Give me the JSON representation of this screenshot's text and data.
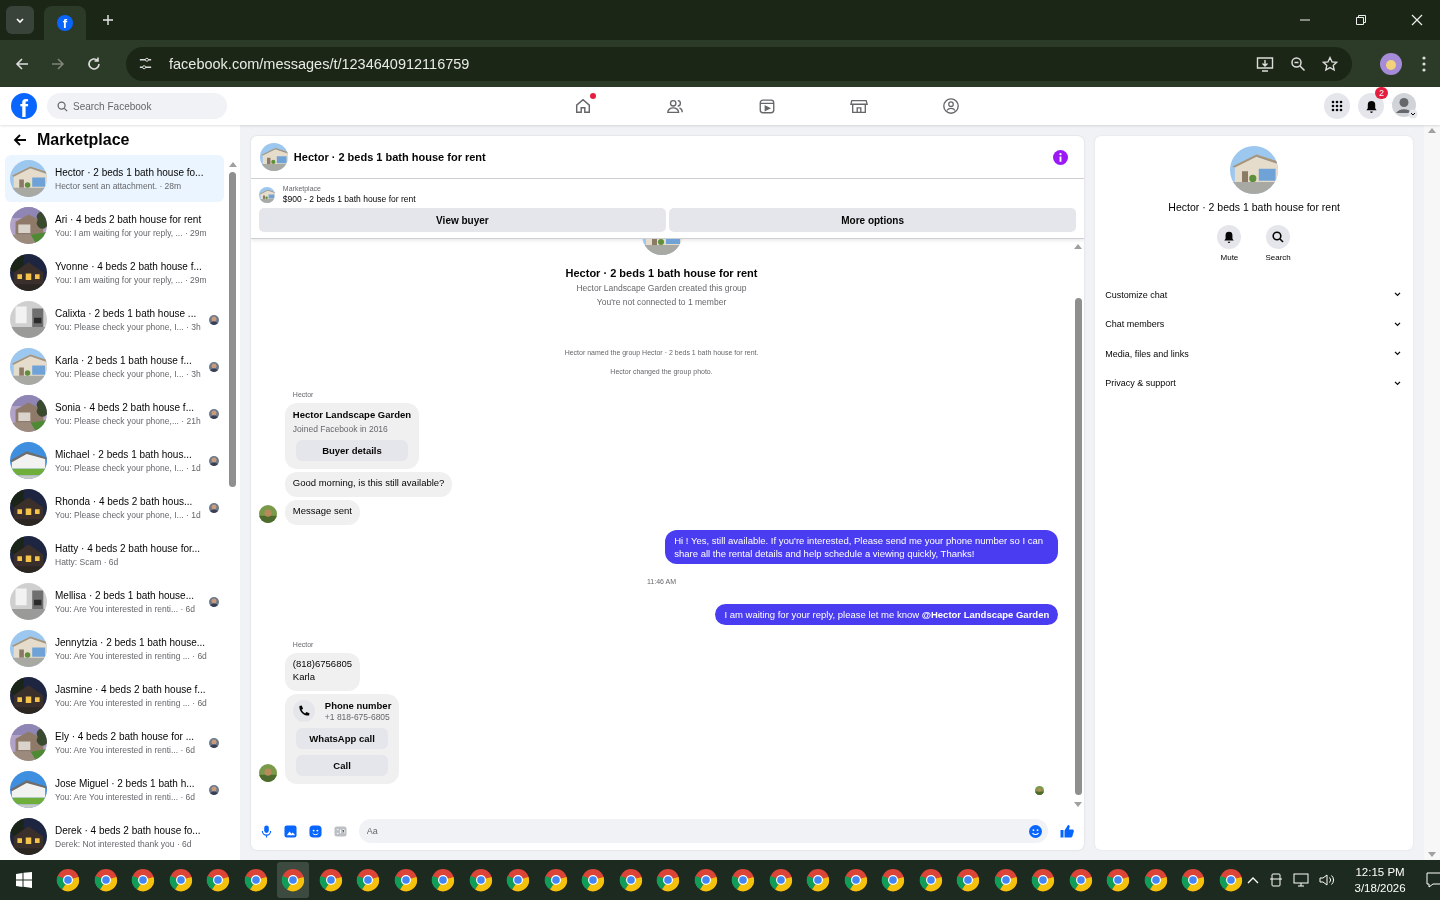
{
  "browser": {
    "favicon": "f",
    "url": "facebook.com/messages/t/1234640912116759"
  },
  "topnav": {
    "logo": "f",
    "search_placeholder": "Search Facebook",
    "notifications_badge": "2"
  },
  "sidebar": {
    "title": "Marketplace",
    "conversations": [
      {
        "title": "Hector · 2 beds 1 bath house fo...",
        "preview": "Hector sent an attachment. · 28m",
        "selected": true,
        "seen": false
      },
      {
        "title": "Ari · 4 beds 2 bath house for rent",
        "preview": "You: I am waiting for your reply, ... · 29m",
        "selected": false,
        "seen": false
      },
      {
        "title": "Yvonne · 4 beds 2 bath house f...",
        "preview": "You: I am waiting for your reply, ... · 29m",
        "selected": false,
        "seen": false
      },
      {
        "title": "Calixta · 2 beds 1 bath house ...",
        "preview": "You: Please check your phone, I... · 3h",
        "selected": false,
        "seen": true
      },
      {
        "title": "Karla · 2 beds 1 bath house f...",
        "preview": "You: Please check your phone, I... · 3h",
        "selected": false,
        "seen": true
      },
      {
        "title": "Sonia · 4 beds 2 bath house f...",
        "preview": "You: Please check your phone,... · 21h",
        "selected": false,
        "seen": true
      },
      {
        "title": "Michael · 2 beds 1 bath hous...",
        "preview": "You: Please check your phone, I... · 1d",
        "selected": false,
        "seen": true
      },
      {
        "title": "Rhonda · 4 beds 2 bath hous...",
        "preview": "You: Please check your phone, I... · 1d",
        "selected": false,
        "seen": true
      },
      {
        "title": "Hatty · 4 beds 2 bath house for...",
        "preview": "Hatty: Scam · 6d",
        "selected": false,
        "seen": false
      },
      {
        "title": "Mellisa · 2 beds 1 bath house...",
        "preview": "You: Are You interested in renti... · 6d",
        "selected": false,
        "seen": true
      },
      {
        "title": "Jennytzia · 2 beds 1 bath house...",
        "preview": "You: Are You interested in renting ... · 6d",
        "selected": false,
        "seen": false
      },
      {
        "title": "Jasmine · 4 beds 2 bath house f...",
        "preview": "You: Are You interested in renting ... · 6d",
        "selected": false,
        "seen": false
      },
      {
        "title": "Ely · 4 beds 2 bath house for ...",
        "preview": "You: Are You interested in renti... · 6d",
        "selected": false,
        "seen": true
      },
      {
        "title": "Jose Miguel · 2 beds 1 bath h...",
        "preview": "You: Are You interested in renti... · 6d",
        "selected": false,
        "seen": true
      },
      {
        "title": "Derek · 4 beds 2 bath house fo...",
        "preview": "Derek: Not interested thank you · 6d",
        "selected": false,
        "seen": false
      }
    ]
  },
  "chat": {
    "title": "Hector · 2 beds 1 bath house for rent",
    "listing_label": "Marketplace",
    "listing": "$900 - 2 beds 1 bath house for rent",
    "buttons": [
      "View buyer",
      "More options"
    ],
    "intro_title": "Hector · 2 beds 1 bath house for rent",
    "intro_lines": [
      "Hector Landscape Garden created this group",
      "You're not connected to 1 member"
    ],
    "events": [
      "Hector named the group Hector · 2 beds 1 bath house for rent.",
      "Hector changed the group photo."
    ],
    "messages": [
      {
        "kind": "sender",
        "text": "Hector"
      },
      {
        "kind": "profile",
        "name": "Hector Landscape Garden",
        "sub": "Joined Facebook in 2016",
        "button": "Buyer details",
        "avatar": false
      },
      {
        "kind": "incoming",
        "text": "Good morning, is this still available?",
        "avatar": false
      },
      {
        "kind": "incoming",
        "text": "Message sent",
        "avatar": true
      },
      {
        "kind": "outgoing",
        "text": "Hi ! Yes, still available. If you're interested, Please send me your phone number so I can share all the rental details and help schedule a viewing quickly, Thanks!"
      },
      {
        "kind": "time",
        "text": "11:46 AM"
      },
      {
        "kind": "outgoing",
        "text": "I am waiting for your reply, please let me know **@Hector Landscape Garden**"
      },
      {
        "kind": "sender",
        "text": "Hector"
      },
      {
        "kind": "incoming",
        "text": "(818)6756805\nKarla",
        "avatar": false
      },
      {
        "kind": "contact",
        "title": "Phone number",
        "sub": "+1 818-675-6805",
        "buttons": [
          "WhatsApp call",
          "Call"
        ],
        "avatar": true
      }
    ],
    "composer_placeholder": "Aa"
  },
  "details": {
    "title": "Hector · 2 beds 1 bath house for rent",
    "actions": [
      "Mute",
      "Search"
    ],
    "sections": [
      {
        "label": "Customize chat",
        "expanded": false
      },
      {
        "label": "Chat members",
        "expanded": false
      },
      {
        "label": "Media, files and links",
        "expanded": false
      },
      {
        "label": "Privacy & support",
        "expanded": false
      }
    ]
  },
  "taskbar": {
    "time": "12:15 PM",
    "date": "3/18/2026",
    "apps": [
      {
        "active": false
      },
      {
        "active": false
      },
      {
        "active": false
      },
      {
        "active": false
      },
      {
        "active": false
      },
      {
        "active": false
      },
      {
        "active": true
      },
      {
        "active": false
      },
      {
        "active": false
      },
      {
        "active": false
      },
      {
        "active": false
      },
      {
        "active": false
      },
      {
        "active": false
      },
      {
        "active": false
      },
      {
        "active": false
      },
      {
        "active": false
      },
      {
        "active": false
      },
      {
        "active": false
      },
      {
        "active": false
      },
      {
        "active": false
      },
      {
        "active": false
      },
      {
        "active": false
      },
      {
        "active": false
      },
      {
        "active": false
      },
      {
        "active": false
      },
      {
        "active": false
      },
      {
        "active": false
      },
      {
        "active": false
      },
      {
        "active": false
      },
      {
        "active": false
      },
      {
        "active": false
      },
      {
        "active": false
      }
    ]
  }
}
